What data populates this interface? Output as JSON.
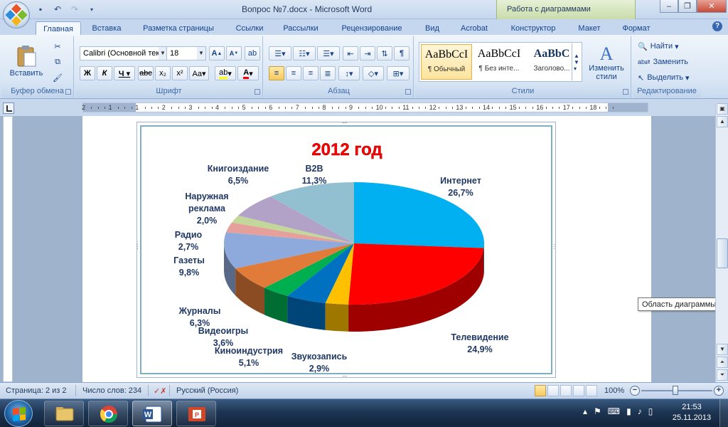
{
  "window": {
    "title": "Вопрос №7.docx - Microsoft Word",
    "context_title": "Работа с диаграммами"
  },
  "tabs": [
    "Главная",
    "Вставка",
    "Разметка страницы",
    "Ссылки",
    "Рассылки",
    "Рецензирование",
    "Вид",
    "Acrobat",
    "Конструктор",
    "Макет",
    "Формат"
  ],
  "ribbon": {
    "clipboard": {
      "paste_label": "Вставить",
      "group_label": "Буфер обмена"
    },
    "font": {
      "name": "Calibri (Основной текст)",
      "size": "18",
      "group_label": "Шрифт"
    },
    "paragraph": {
      "group_label": "Абзац"
    },
    "styles": {
      "items": [
        {
          "sample": "AaBbCcI",
          "name": "¶ Обычный"
        },
        {
          "sample": "AaBbCcI",
          "name": "¶ Без инте..."
        },
        {
          "sample": "AaBbC",
          "name": "Заголово..."
        }
      ],
      "change_label": "Изменить стили",
      "group_label": "Стили"
    },
    "editing": {
      "find_label": "Найти",
      "replace_label": "Заменить",
      "select_label": "Выделить",
      "group_label": "Редактирование"
    }
  },
  "ruler_numbers": [
    "2",
    "1",
    "1",
    "2",
    "3",
    "4",
    "5",
    "6",
    "7",
    "8",
    "9",
    "10",
    "11",
    "12",
    "13",
    "14",
    "15",
    "16",
    "17",
    "18"
  ],
  "chart_data": {
    "type": "pie",
    "title": "2012 год",
    "categories": [
      "Интернет",
      "Телевидение",
      "Звукозапись",
      "Киноиндустрия",
      "Видеоигры",
      "Журналы",
      "Газеты",
      "Радио",
      "Наружная реклама",
      "Книгоиздание",
      "B2B"
    ],
    "values": [
      26.7,
      24.9,
      2.9,
      5.1,
      3.6,
      6.3,
      9.8,
      2.7,
      2.0,
      6.5,
      11.3
    ],
    "labels": [
      "26,7%",
      "24,9%",
      "2,9%",
      "5,1%",
      "3,6%",
      "6,3%",
      "9,8%",
      "2,7%",
      "2,0%",
      "6,5%",
      "11,3%"
    ],
    "colors": [
      "#00b0f0",
      "#ff0000",
      "#ffc000",
      "#0070c0",
      "#00b050",
      "#e07b39",
      "#8ea9db",
      "#e6a09c",
      "#c4d79b",
      "#b3a2c7",
      "#93c0d1"
    ],
    "title_color": "#ff0000",
    "legend": "none"
  },
  "tooltip": "Область диаграммы",
  "status": {
    "page": "Страница: 2 из 2",
    "words": "Число слов: 234",
    "language": "Русский (Россия)",
    "zoom": "100%"
  },
  "clock": {
    "time": "21:53",
    "date": "25.11.2013"
  }
}
